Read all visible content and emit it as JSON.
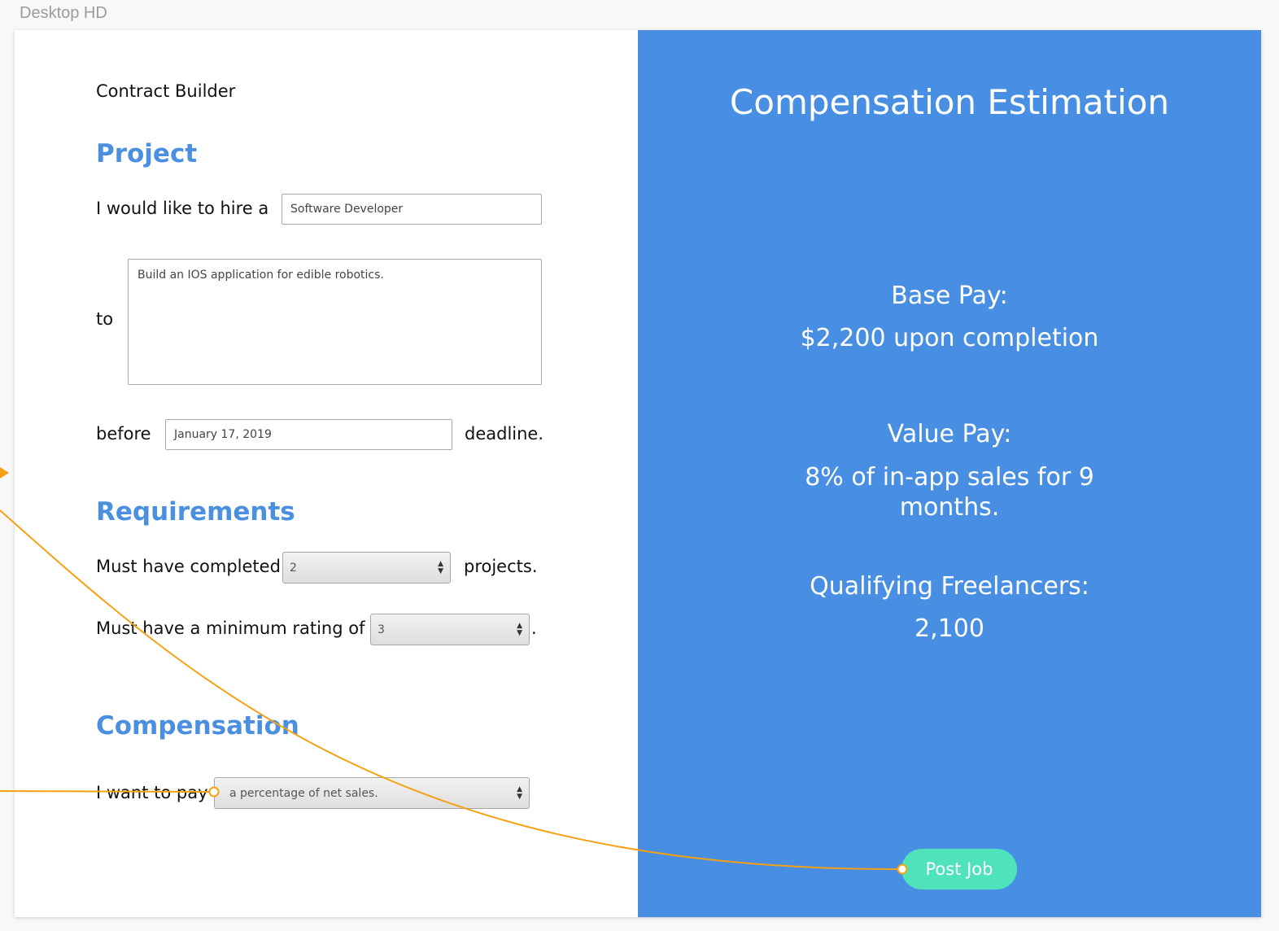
{
  "canvas": {
    "label": "Desktop HD"
  },
  "form": {
    "app_title": "Contract Builder",
    "project": {
      "heading": "Project",
      "hire_prefix": "I would like to hire a",
      "role_value": "Software Developer",
      "to_label": "to",
      "description_value": "Build an IOS application for edible robotics.",
      "before_label": "before",
      "deadline_value": "January 17, 2019",
      "deadline_suffix": "deadline."
    },
    "requirements": {
      "heading": "Requirements",
      "completed_prefix": "Must have completed",
      "completed_value": "2",
      "completed_suffix": "projects.",
      "rating_prefix": "Must have a minimum rating of",
      "rating_value": "3",
      "rating_suffix": "."
    },
    "compensation": {
      "heading": "Compensation",
      "pay_prefix": "I want to pay",
      "pay_value": "a percentage of net sales."
    }
  },
  "estimation": {
    "title": "Compensation Estimation",
    "base_pay_label": "Base Pay:",
    "base_pay_value": "$2,200 upon completion",
    "value_pay_label": "Value Pay:",
    "value_pay_value": "8% of in-app sales for 9 months.",
    "freelancers_label": "Qualifying Freelancers:",
    "freelancers_value": "2,100",
    "post_button": "Post Job"
  },
  "colors": {
    "accent_blue": "#488ee3",
    "heading_blue": "#4a8fe0",
    "button_teal": "#4fe3bb",
    "prototype_link": "#f5a113"
  }
}
